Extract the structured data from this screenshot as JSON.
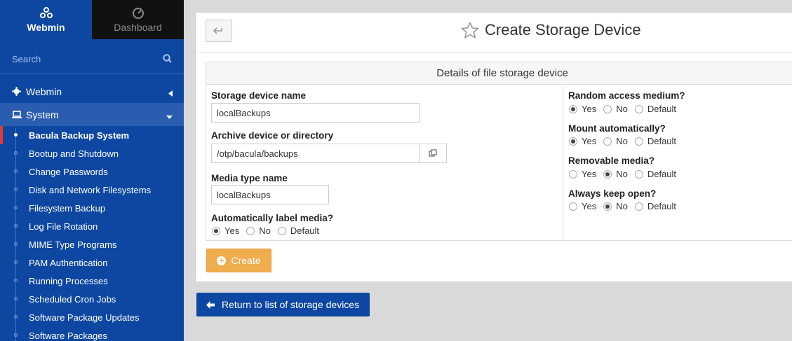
{
  "sidebar": {
    "tabs": [
      {
        "label": "Webmin",
        "icon": "webmin-logo-icon"
      },
      {
        "label": "Dashboard",
        "icon": "dashboard-gauge-icon"
      }
    ],
    "search_placeholder": "Search",
    "categories": [
      {
        "label": "Webmin",
        "icon": "gear-icon"
      },
      {
        "label": "System",
        "icon": "laptop-icon"
      }
    ],
    "items": [
      {
        "label": "Bacula Backup System",
        "active": true
      },
      {
        "label": "Bootup and Shutdown"
      },
      {
        "label": "Change Passwords"
      },
      {
        "label": "Disk and Network Filesystems"
      },
      {
        "label": "Filesystem Backup"
      },
      {
        "label": "Log File Rotation"
      },
      {
        "label": "MIME Type Programs"
      },
      {
        "label": "PAM Authentication"
      },
      {
        "label": "Running Processes"
      },
      {
        "label": "Scheduled Cron Jobs"
      },
      {
        "label": "Software Package Updates"
      },
      {
        "label": "Software Packages"
      }
    ]
  },
  "page": {
    "title": "Create Storage Device",
    "section_title": "Details of file storage device",
    "fields": {
      "device_name": {
        "label": "Storage device name",
        "value": "localBackups"
      },
      "archive_device": {
        "label": "Archive device or directory",
        "value": "/otp/bacula/backups"
      },
      "media_type": {
        "label": "Media type name",
        "value": "localBackups"
      },
      "auto_label": {
        "label": "Automatically label media?",
        "options": [
          "Yes",
          "No",
          "Default"
        ],
        "selected": "Yes"
      },
      "random_access": {
        "label": "Random access medium?",
        "options": [
          "Yes",
          "No",
          "Default"
        ],
        "selected": "Yes"
      },
      "mount_auto": {
        "label": "Mount automatically?",
        "options": [
          "Yes",
          "No",
          "Default"
        ],
        "selected": "Yes"
      },
      "removable": {
        "label": "Removable media?",
        "options": [
          "Yes",
          "No",
          "Default"
        ],
        "selected": "No"
      },
      "keep_open": {
        "label": "Always keep open?",
        "options": [
          "Yes",
          "No",
          "Default"
        ],
        "selected": "No"
      }
    },
    "create_label": "Create",
    "return_label": "Return to list of storage devices"
  },
  "colors": {
    "sidebar_bg": "#0d47a1",
    "active_marker": "#e53935",
    "create_button": "#f0ad4e"
  }
}
